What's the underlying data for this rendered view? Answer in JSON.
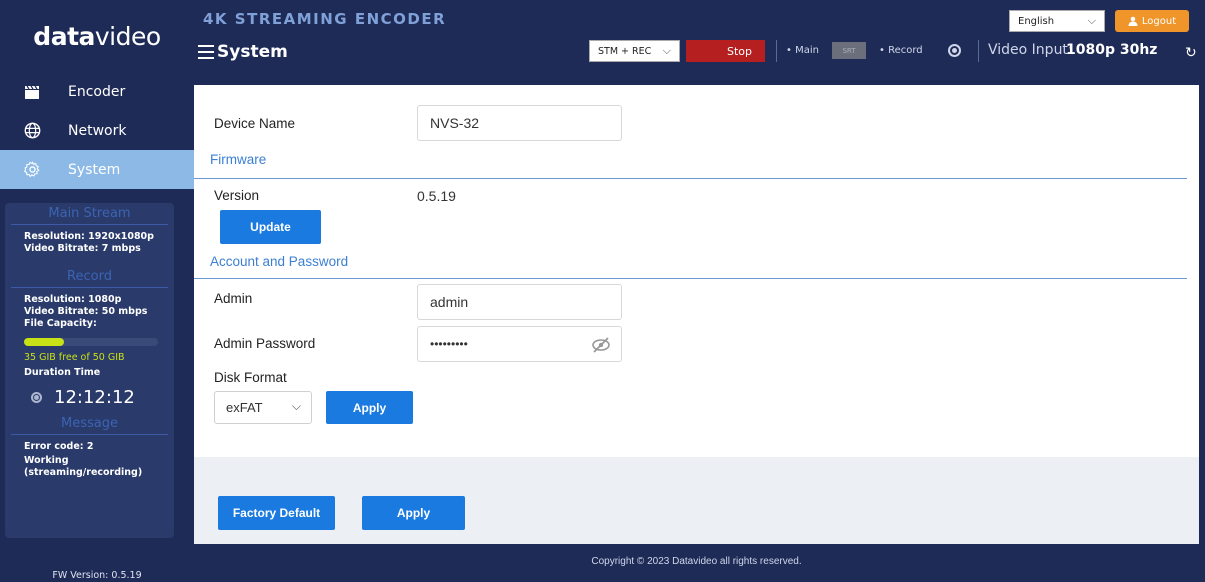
{
  "brand": {
    "logo_bold": "data",
    "logo_light": "video"
  },
  "sidebar": {
    "items": [
      {
        "label": "Encoder",
        "icon": "clapperboard-icon"
      },
      {
        "label": "Network",
        "icon": "globe-icon"
      },
      {
        "label": "System",
        "icon": "gear-icon",
        "active": true
      }
    ],
    "status": {
      "main_stream_heading": "Main Stream",
      "main_resolution": "Resolution: 1920x1080p",
      "main_bitrate": "Video Bitrate: 7 mbps",
      "record_heading": "Record",
      "record_resolution": "Resolution: 1080p",
      "record_bitrate": "Video Bitrate: 50 mbps",
      "file_capacity_label": "File Capacity:",
      "capacity_used_fraction": 0.3,
      "capacity_text": "35 GIB free of 50 GIB",
      "duration_label": "Duration Time",
      "duration_value": "12:12:12",
      "message_heading": "Message",
      "error_code": "Error code: 2",
      "working_line1": "Working",
      "working_line2": "(streaming/recording)"
    },
    "fw_version": "FW Version: 0.5.19"
  },
  "header": {
    "product": "4K STREAMING ENCODER",
    "title": "System",
    "language": "English",
    "logout_label": "Logout",
    "mode_value": "STM + REC",
    "stop_label": "Stop",
    "main_label": "• Main",
    "srt_badge": "SRT",
    "record_label": "• Record",
    "video_input_label": "Video Input:",
    "video_input_value": "1080p 30hz",
    "refresh_glyph": "↻"
  },
  "form": {
    "device_name_label": "Device Name",
    "device_name_value": "NVS-32",
    "firmware_heading": "Firmware",
    "version_label": "Version",
    "version_value": "0.5.19",
    "update_label": "Update",
    "account_heading": "Account and Password",
    "admin_label": "Admin",
    "admin_value": "admin",
    "password_label": "Admin Password",
    "password_value": "•••••••••",
    "disk_format_label": "Disk Format",
    "disk_format_value": "exFAT",
    "disk_apply_label": "Apply"
  },
  "footer": {
    "factory_default_label": "Factory Default",
    "apply_label": "Apply",
    "copyright": "Copyright © 2023 Datavideo all rights reserved."
  },
  "colors": {
    "navy": "#1f2b57",
    "active_nav": "#8cb9e6",
    "primary_button": "#1a7ae0",
    "stop_red": "#b51f1f",
    "logout_orange": "#f0952a",
    "capacity_green": "#c8e016"
  }
}
